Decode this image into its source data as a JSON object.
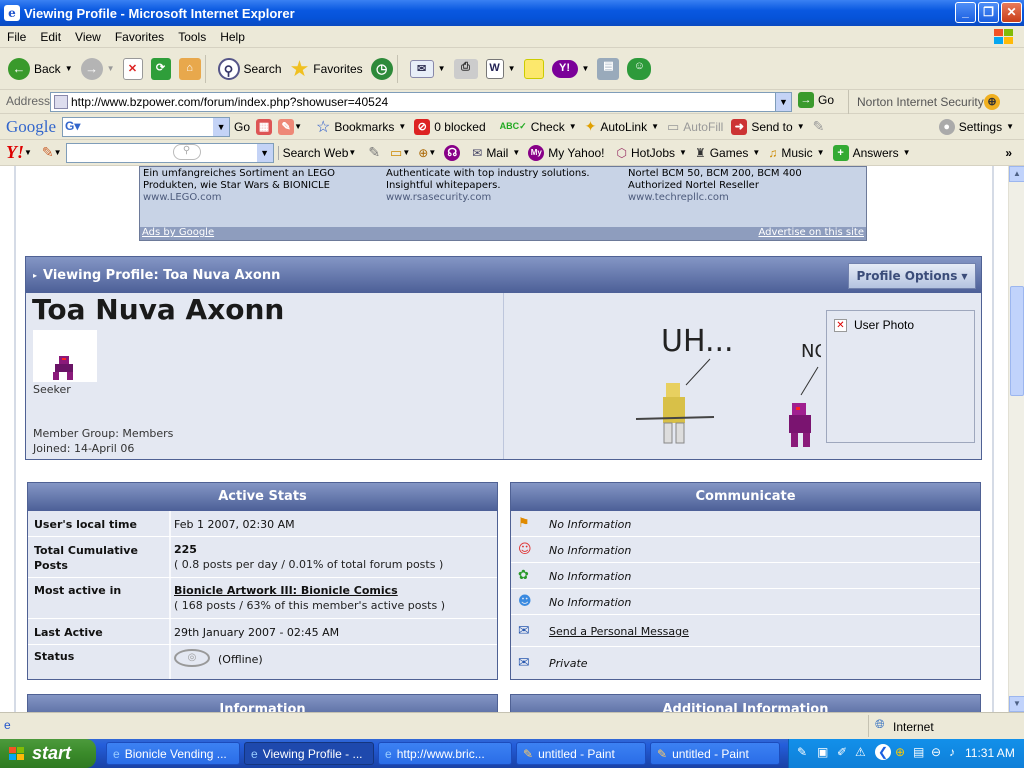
{
  "window": {
    "title": "Viewing Profile - Microsoft Internet Explorer"
  },
  "menu": [
    "File",
    "Edit",
    "View",
    "Favorites",
    "Tools",
    "Help"
  ],
  "toolbar": {
    "back": "Back",
    "search": "Search",
    "favorites": "Favorites"
  },
  "address": {
    "label": "Address",
    "url": "http://www.bzpower.com/forum/index.php?showuser=40524",
    "go": "Go",
    "norton": "Norton Internet Security"
  },
  "google": {
    "logo": "Google",
    "go": "Go",
    "bookmarks": "Bookmarks",
    "blocked": "0 blocked",
    "check": "Check",
    "autolink": "AutoLink",
    "autofill": "AutoFill",
    "sendto": "Send to",
    "settings": "Settings"
  },
  "yahoo": {
    "logo": "Y!",
    "search_web": "Search Web",
    "mail": "Mail",
    "my_yahoo": "My Yahoo!",
    "hotjobs": "HotJobs",
    "games": "Games",
    "music": "Music",
    "answers": "Answers"
  },
  "ads": [
    {
      "line1": "Ein umfangreiches Sortiment an LEGO",
      "line2": "Produkten, wie Star Wars & BIONICLE",
      "url": "www.LEGO.com"
    },
    {
      "line1": "Authenticate with top industry solutions.",
      "line2": "Insightful whitepapers.",
      "url": "www.rsasecurity.com"
    },
    {
      "line1": "Nortel BCM 50, BCM 200, BCM 400",
      "line2": "Authorized Nortel Reseller",
      "url": "www.techrepllc.com"
    }
  ],
  "ads_footer": {
    "left": "Ads by Google",
    "right": "Advertise on this site"
  },
  "profile": {
    "header": "Viewing Profile: Toa Nuva Axonn",
    "options": "Profile Options",
    "name": "Toa Nuva Axonn",
    "rank": "Seeker",
    "group": "Member Group: Members",
    "joined": "Joined: 14-April 06",
    "user_photo": "User Photo",
    "sig_text1": "UH...",
    "sig_text2": "NO!"
  },
  "active_stats": {
    "title": "Active Stats",
    "rows": [
      {
        "label": "User's local time",
        "value": "Feb 1 2007, 02:30 AM"
      },
      {
        "label": "Total Cumulative Posts",
        "value": "225",
        "sub": "( 0.8 posts per day / 0.01% of total forum posts )"
      },
      {
        "label": "Most active in",
        "value": "Bionicle Artwork III: Bionicle Comics",
        "sub": "( 168 posts / 63% of this member's active posts )"
      },
      {
        "label": "Last Active",
        "value": "29th January 2007 - 02:45 AM"
      },
      {
        "label": "Status",
        "value": "(Offline)"
      }
    ]
  },
  "communicate": {
    "title": "Communicate",
    "rows": [
      "No Information",
      "No Information",
      "No Information",
      "No Information",
      "Send a Personal Message",
      "Private"
    ]
  },
  "bottom_panels": {
    "left": "Information",
    "right": "Additional Information"
  },
  "statusbar": {
    "zone": "Internet"
  },
  "taskbar": {
    "start": "start",
    "tasks": [
      "Bionicle Vending ...",
      "Viewing Profile - ...",
      "http://www.bric...",
      "untitled - Paint",
      "untitled - Paint"
    ],
    "clock": "11:31 AM"
  }
}
